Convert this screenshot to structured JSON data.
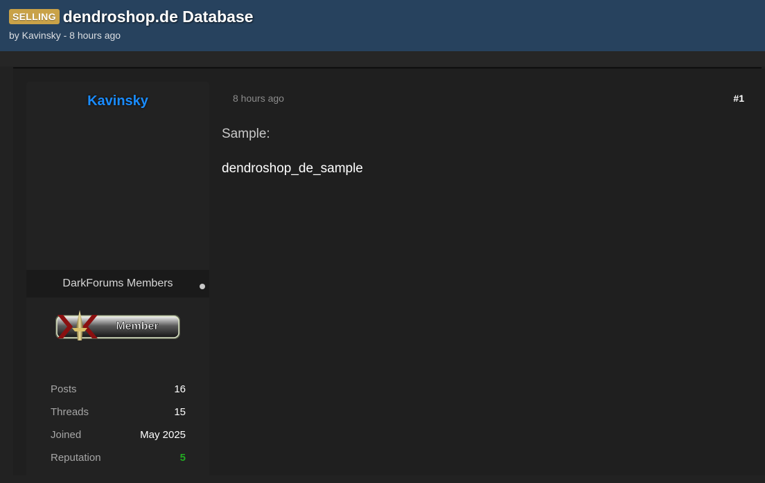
{
  "thread": {
    "prefix": "SELLING",
    "title": "dendroshop.de Database",
    "byline": "by Kavinsky - 8 hours ago"
  },
  "author": {
    "name": "Kavinsky",
    "usergroup": "DarkForums Members",
    "badge_icon": "member-rank-badge",
    "badge_text": "Member",
    "stats": [
      {
        "label": "Posts",
        "value": "16"
      },
      {
        "label": "Threads",
        "value": "15"
      },
      {
        "label": "Joined",
        "value": "May 2025"
      },
      {
        "label": "Reputation",
        "value": "5"
      }
    ]
  },
  "post": {
    "date": "8 hours ago",
    "number": "#1",
    "sample_label": "Sample:",
    "sample_link": "dendroshop_de_sample"
  },
  "colors": {
    "header_bg": "#27425e",
    "prefix_bg": "#c9a248",
    "author_name": "#1a8cff",
    "reputation": "#22aa22",
    "page_bg": "#1f1f1f"
  }
}
